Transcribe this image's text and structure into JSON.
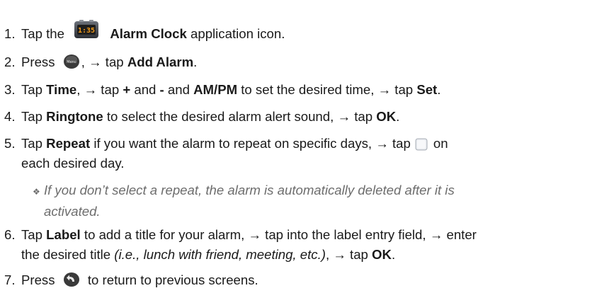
{
  "steps": [
    {
      "num": "1.",
      "t1": "Tap the",
      "b1": "Alarm Clock",
      "t2": " application icon.",
      "icon_label": "1:35"
    },
    {
      "num": "2.",
      "t1": "Press",
      "t2": ", → tap ",
      "b1": "Add Alarm",
      "t3": ".",
      "icon_label": "Menu"
    },
    {
      "num": "3.",
      "t1": "Tap ",
      "b1": "Time",
      "t2": ", → tap ",
      "b2": "+",
      "t3": " and ",
      "b3": "-",
      "t4": " and ",
      "b4": "AM/PM",
      "t5": " to set the desired time, → tap ",
      "b5": "Set",
      "t6": "."
    },
    {
      "num": "4.",
      "t1": "Tap ",
      "b1": "Ringtone",
      "t2": " to select the desired alarm alert sound, → tap ",
      "b2": "OK",
      "t3": "."
    },
    {
      "num": "5.",
      "t1": "Tap ",
      "b1": "Repeat",
      "t2": " if you want the alarm to repeat on specific days, → tap",
      "t3": "on",
      "line2": "each desired day."
    },
    {
      "num": "6.",
      "t1": "Tap ",
      "b1": "Label",
      "t2": " to add a title for your alarm, → tap into the label entry field, → enter",
      "line2a": "the desired title ",
      "line2i": "(i.e., lunch with friend, meeting, etc.)",
      "line2b": ", → tap ",
      "line2bold": "OK",
      "line2c": "."
    },
    {
      "num": "7.",
      "t1": "Press",
      "t2": "to return to previous screens."
    }
  ],
  "note": {
    "bullet": "❖",
    "line1": "If you don’t select a repeat, the alarm is automatically deleted after it is",
    "line2": "activated."
  },
  "icons": {
    "alarm_clock": "alarm-clock-app-icon",
    "menu_key": "menu-key-icon",
    "back_key": "back-key-icon",
    "checkbox": "checkbox-icon"
  },
  "colors": {
    "text": "#1a1a1a",
    "note": "#6d6d6d",
    "clock_orange": "#f29a1a"
  }
}
